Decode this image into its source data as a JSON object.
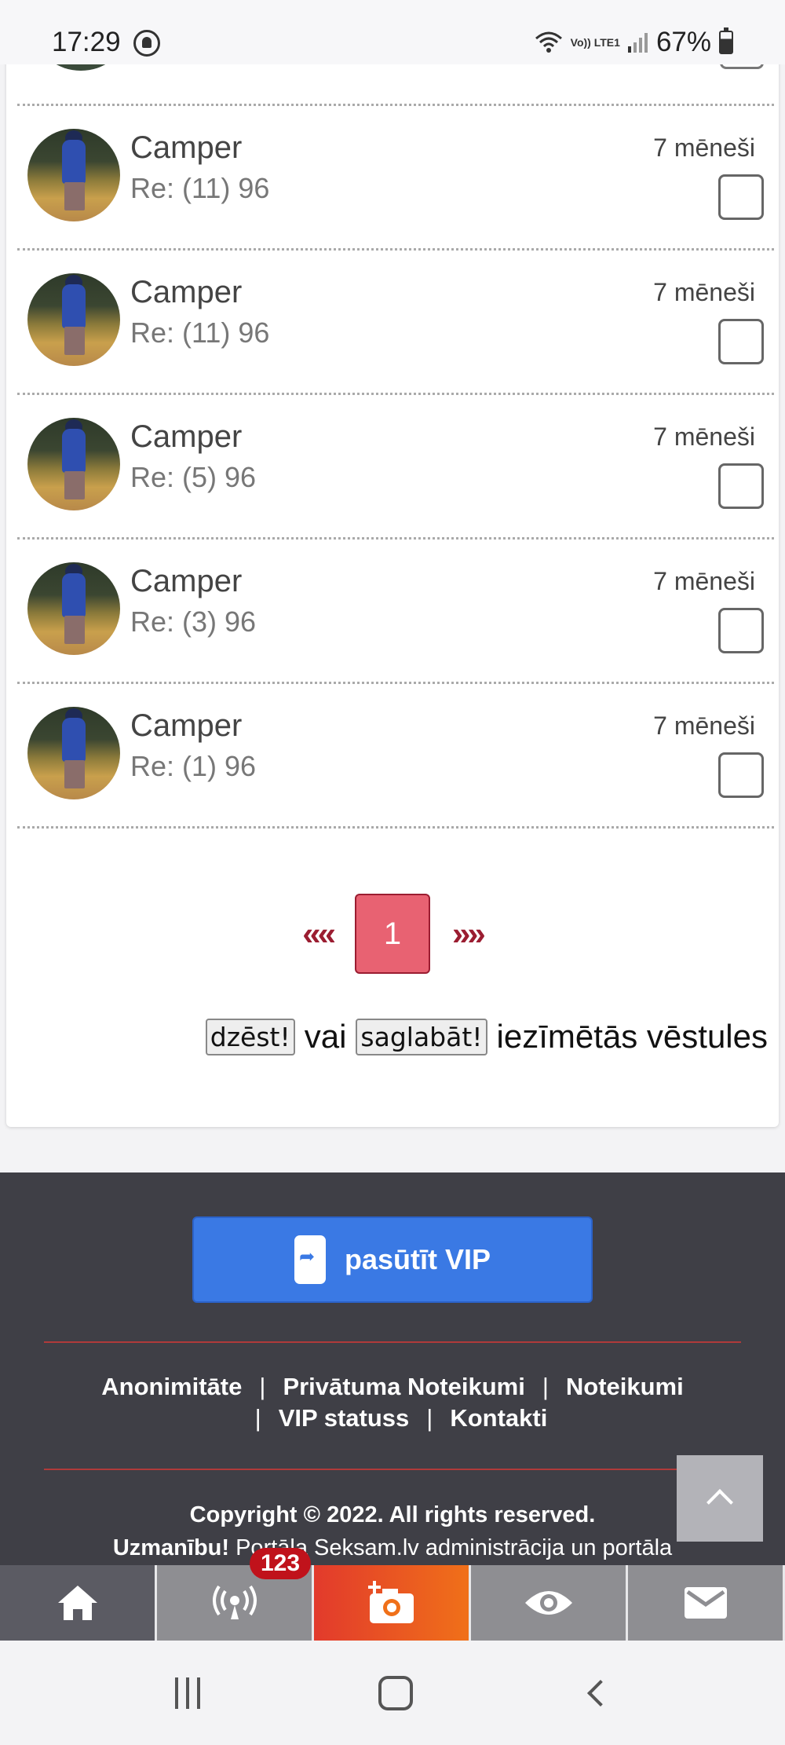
{
  "status_bar": {
    "time": "17:29",
    "network_label": "Vo)) LTE1",
    "battery": "67%",
    "battery_level": 0.67
  },
  "messages": [
    {
      "sender": "Camper",
      "subject": "Re: (11) 96",
      "time": "7 mēneši",
      "checked": false
    },
    {
      "sender": "Camper",
      "subject": "Re: (11) 96",
      "time": "7 mēneši",
      "checked": false
    },
    {
      "sender": "Camper",
      "subject": "Re: (5) 96",
      "time": "7 mēneši",
      "checked": false
    },
    {
      "sender": "Camper",
      "subject": "Re: (3) 96",
      "time": "7 mēneši",
      "checked": false
    },
    {
      "sender": "Camper",
      "subject": "Re: (1) 96",
      "time": "7 mēneši",
      "checked": false
    }
  ],
  "pagination": {
    "prev": "««",
    "current": "1",
    "next": "»»"
  },
  "actions": {
    "delete_label": "dzēst!",
    "or_text": "vai",
    "save_label": "saglabāt!",
    "suffix_text": "iezīmētās vēstules"
  },
  "footer": {
    "vip_button": "pasūtīt VIP",
    "links": [
      "Anonimitāte",
      "Privātuma Noteikumi",
      "Noteikumi",
      "VIP statuss",
      "Kontakti"
    ],
    "separator": "|",
    "copyright": "Copyright © 2022. All rights reserved.",
    "warning_bold": "Uzmanību!",
    "warning_text": "Portāla Seksam.lv administrācija un portāla"
  },
  "tabbar": {
    "items": [
      "home-icon",
      "broadcast-icon",
      "add-photo-icon",
      "eye-icon",
      "mail-icon"
    ],
    "badge": "123"
  },
  "colors": {
    "accent": "#9b1d31",
    "page_active": "#e86272",
    "vip_blue": "#3a79e4",
    "footer_bg": "#3f3f46",
    "camera_tab": "#f07019"
  }
}
